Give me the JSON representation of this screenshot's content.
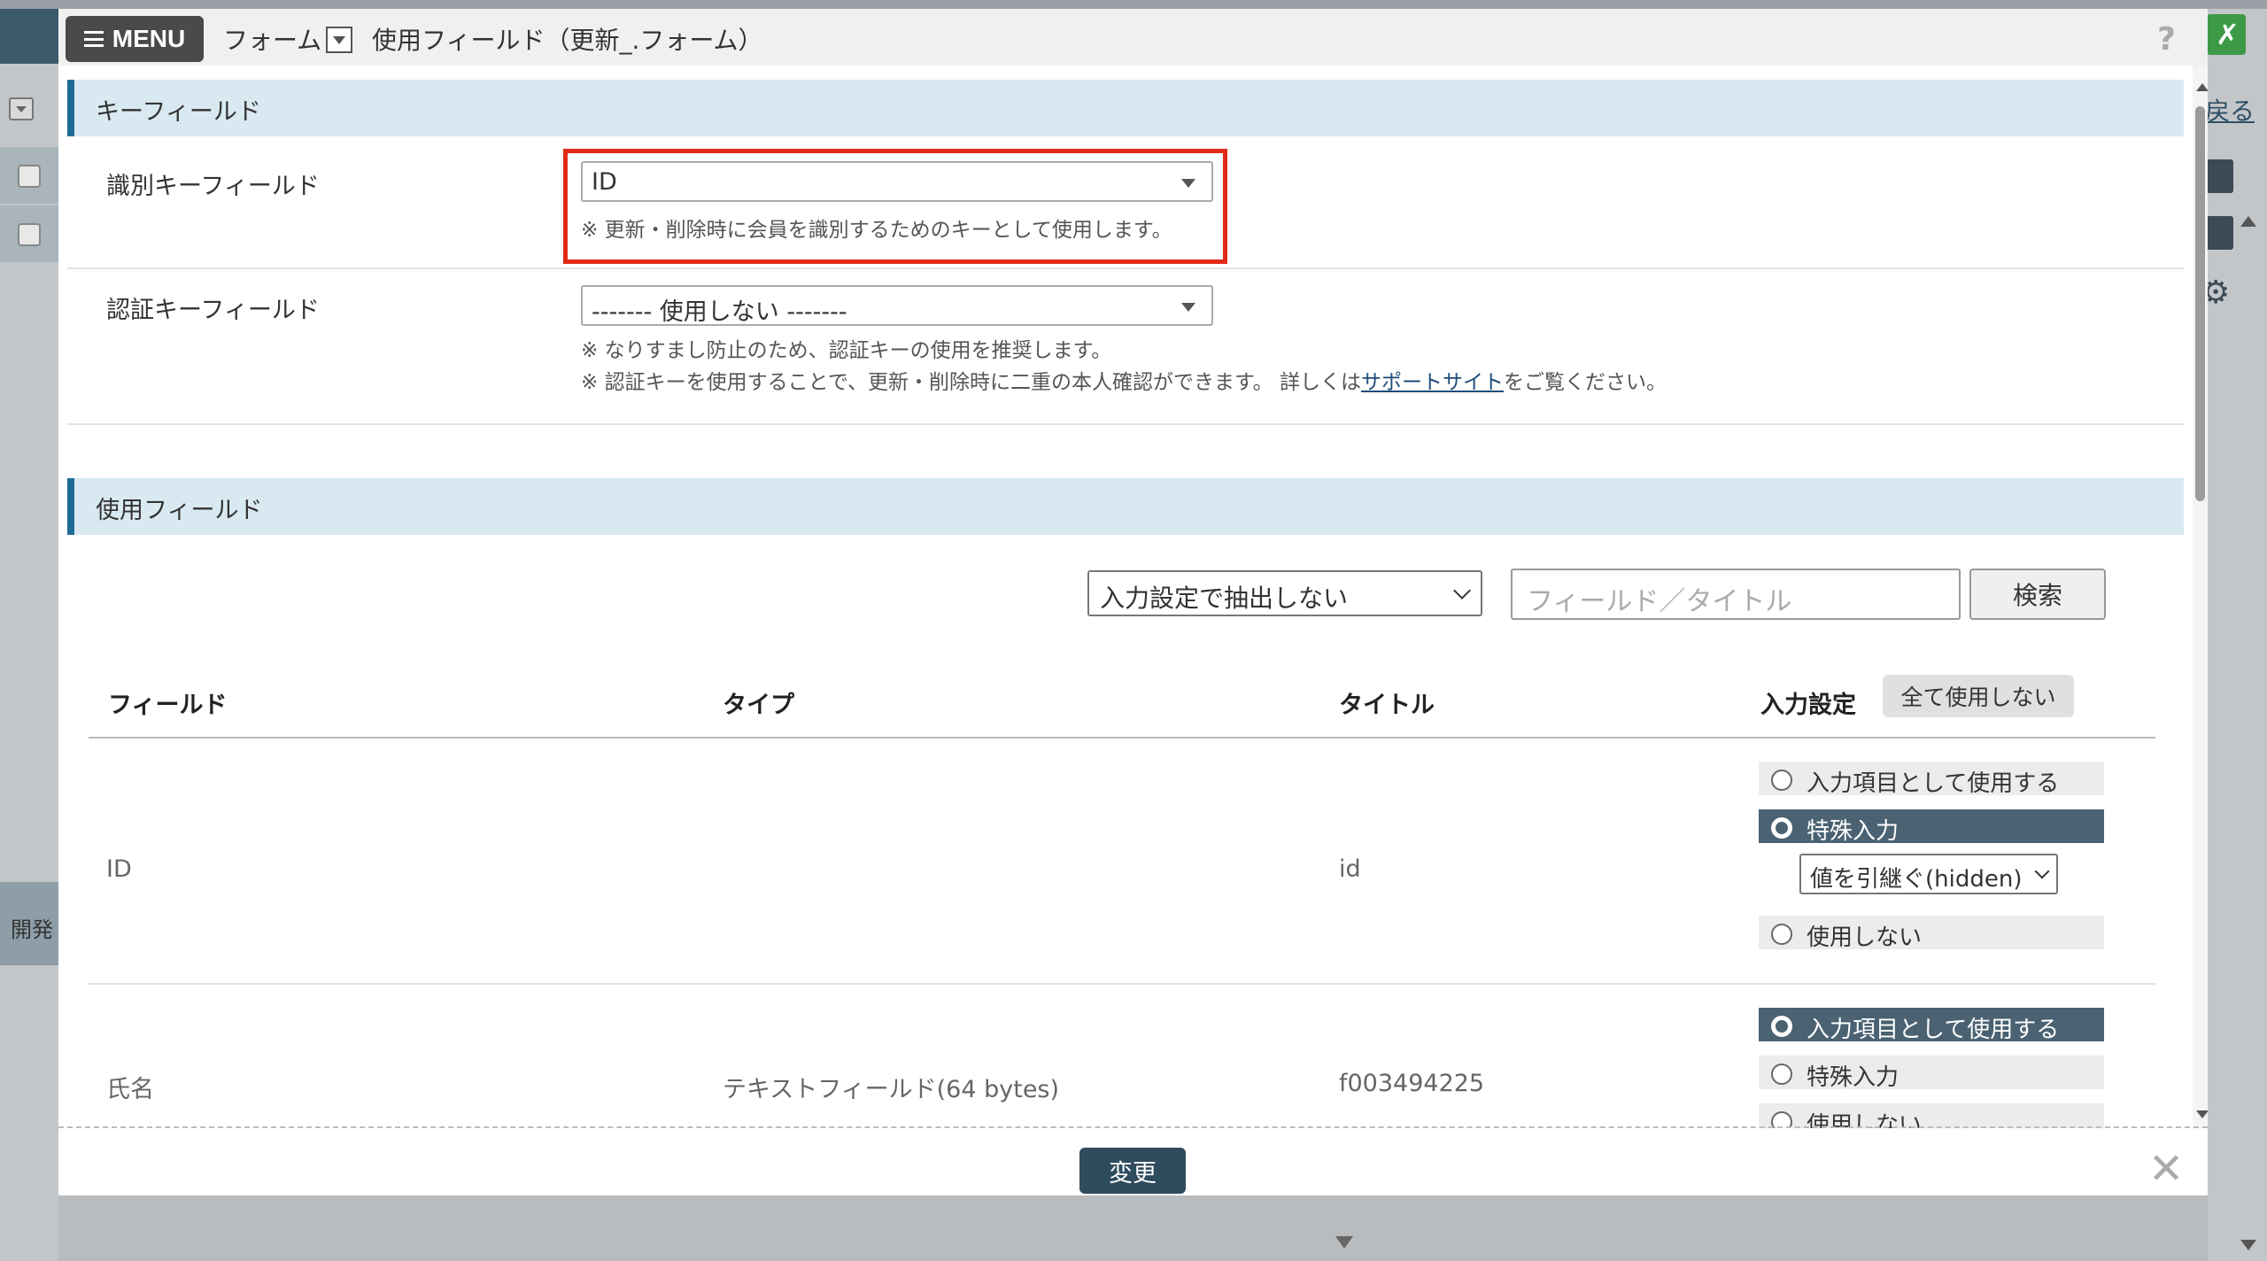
{
  "background": {
    "side_label": "開発",
    "back_link": "戻る"
  },
  "header": {
    "menu_label": "MENU",
    "breadcrumb_form": "フォーム",
    "page_title": "使用フィールド（更新_.フォーム）",
    "help_glyph": "?"
  },
  "key_section": {
    "title": "キーフィールド",
    "identification": {
      "label": "識別キーフィールド",
      "selected": "ID",
      "note": "※ 更新・削除時に会員を識別するためのキーとして使用します。"
    },
    "authentication": {
      "label": "認証キーフィールド",
      "selected": "------- 使用しない -------",
      "note1": "※ なりすまし防止のため、認証キーの使用を推奨します。",
      "note2_prefix": "※ 認証キーを使用することで、更新・削除時に二重の本人確認ができます。 詳しくは",
      "note2_link": "サポートサイト",
      "note2_suffix": "をご覧ください。"
    }
  },
  "fields_section": {
    "title": "使用フィールド",
    "filter_selected": "入力設定で抽出しない",
    "search_placeholder": "フィールド／タイトル",
    "search_button": "検索",
    "columns": {
      "field": "フィールド",
      "type": "タイプ",
      "title": "タイトル",
      "input_setting": "入力設定"
    },
    "all_unused_button": "全て使用しない",
    "rows": [
      {
        "field": "ID",
        "type": "",
        "title": "id",
        "options": [
          "入力項目として使用する",
          "特殊入力",
          "使用しない"
        ],
        "selected_option": "特殊入力",
        "special_select": "値を引継ぐ(hidden)"
      },
      {
        "field": "氏名",
        "type": "テキストフィールド(64 bytes)",
        "title": "f003494225",
        "options": [
          "入力項目として使用する",
          "特殊入力",
          "使用しない"
        ],
        "selected_option": "入力項目として使用する"
      }
    ]
  },
  "footer": {
    "submit_label": "変更",
    "close_glyph": "✕"
  },
  "colors": {
    "accent": "#1e6c95",
    "section_bg": "#d9e9f1",
    "highlight": "#e02a18",
    "selected_radio": "#4a6272",
    "submit": "#2f4b5e"
  }
}
